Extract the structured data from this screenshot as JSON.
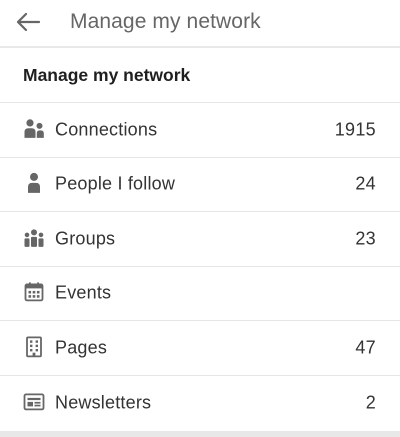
{
  "header": {
    "title": "Manage my network",
    "back_icon": "arrow-left-icon"
  },
  "section": {
    "title": "Manage my network"
  },
  "items": [
    {
      "label": "Connections",
      "count": "1915",
      "icon": "people-icon"
    },
    {
      "label": "People I follow",
      "count": "24",
      "icon": "person-icon"
    },
    {
      "label": "Groups",
      "count": "23",
      "icon": "group-icon"
    },
    {
      "label": "Events",
      "count": "",
      "icon": "calendar-icon"
    },
    {
      "label": "Pages",
      "count": "47",
      "icon": "building-icon"
    },
    {
      "label": "Newsletters",
      "count": "2",
      "icon": "newsletter-icon"
    }
  ],
  "colors": {
    "icon": "#666666",
    "text": "#333333",
    "divider": "#e6e6e6"
  }
}
